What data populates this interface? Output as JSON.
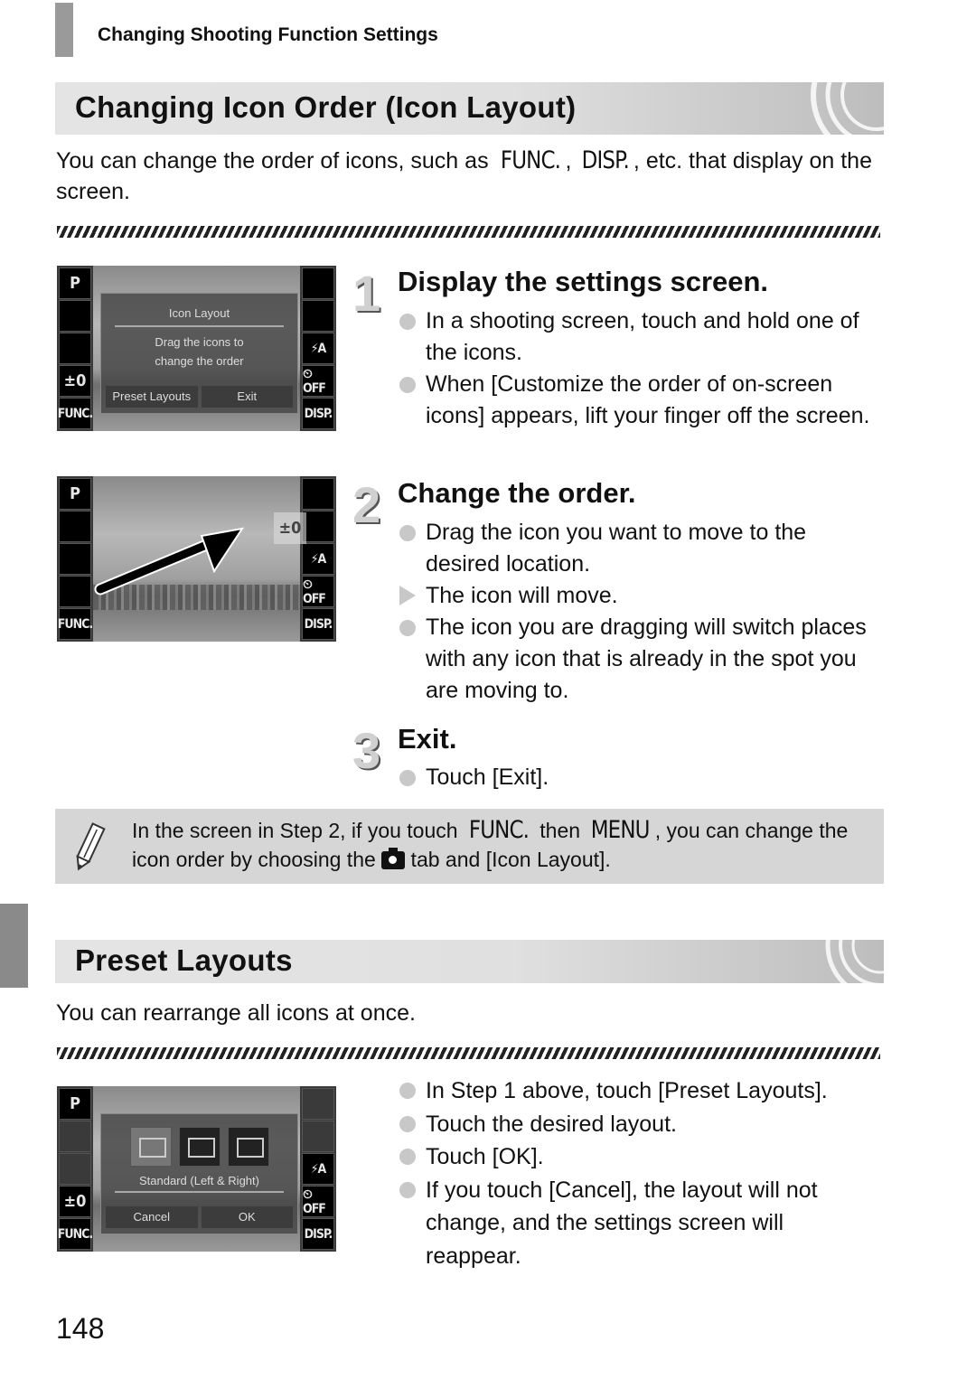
{
  "header": {
    "running_title": "Changing Shooting Function Settings"
  },
  "section1": {
    "title": "Changing Icon Order (Icon Layout)",
    "intro_before": "You can change the order of icons, such as ",
    "intro_kw1": "FUNC.",
    "intro_sep": ", ",
    "intro_kw2": "DISP.",
    "intro_after": ", etc. that display on the screen.",
    "steps": [
      {
        "number": "1",
        "title": "Display the settings screen.",
        "bullets": [
          {
            "type": "circle",
            "text": "In a shooting screen, touch and hold one of the icons."
          },
          {
            "type": "circle",
            "text": "When [Customize the order of on-screen icons] appears, lift your finger off the screen."
          }
        ]
      },
      {
        "number": "2",
        "title": "Change the order.",
        "bullets": [
          {
            "type": "circle",
            "text": "Drag the icon you want to move to the desired location."
          },
          {
            "type": "triangle",
            "text": "The icon will move."
          },
          {
            "type": "circle",
            "text": "The icon you are dragging will switch places with any icon that is already in the spot you are moving to."
          }
        ]
      },
      {
        "number": "3",
        "title": "Exit.",
        "bullets": [
          {
            "type": "circle",
            "text": "Touch [Exit]."
          }
        ]
      }
    ],
    "screen1": {
      "left_icons": [
        "P",
        "",
        "",
        "±0",
        "FUNC."
      ],
      "right_icons": [
        "",
        "",
        "⚡A",
        "⏲OFF",
        "DISP."
      ],
      "dialog_title": "Icon Layout",
      "dialog_message_line1": "Drag the icons to",
      "dialog_message_line2": "change the order",
      "button_preset": "Preset Layouts",
      "button_exit": "Exit"
    },
    "screen2": {
      "left_icons": [
        "P",
        "",
        "",
        "",
        "FUNC."
      ],
      "right_icons": [
        "",
        "",
        "⚡A",
        "⏲OFF",
        "DISP."
      ],
      "dragged_icon": "±0"
    }
  },
  "note": {
    "text_a": "In the screen in Step 2, if you touch ",
    "kw_func": "FUNC.",
    "text_b": " then ",
    "kw_menu": "MENU",
    "text_c": ", you can change the icon order by choosing the ",
    "text_d": " tab and [Icon Layout].",
    "icon": "pencil-icon"
  },
  "section2": {
    "title": "Preset Layouts",
    "intro": "You can rearrange all icons at once.",
    "bullets": [
      {
        "type": "circle",
        "text": "In Step 1 above, touch [Preset Layouts]."
      },
      {
        "type": "circle",
        "text": "Touch the desired layout."
      },
      {
        "type": "circle",
        "text": "Touch [OK]."
      },
      {
        "type": "circle",
        "text": "If you touch [Cancel], the layout will not change, and the settings screen will reappear."
      }
    ],
    "screen3": {
      "left_icons": [
        "P",
        "",
        "",
        "±0",
        "FUNC."
      ],
      "right_icons": [
        "",
        "",
        "⚡A",
        "⏲OFF",
        "DISP."
      ],
      "layout_label": "Standard (Left & Right)",
      "button_cancel": "Cancel",
      "button_ok": "OK"
    }
  },
  "page_number": "148"
}
